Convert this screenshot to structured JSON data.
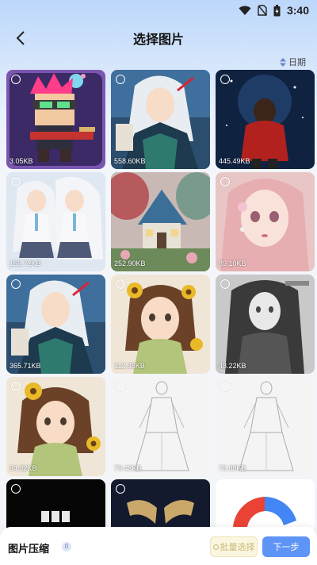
{
  "status": {
    "time": "3:40",
    "icons": [
      "wifi-icon",
      "no-sim-icon",
      "battery-icon"
    ]
  },
  "header": {
    "title": "选择图片",
    "back_icon": "back-arrow-icon"
  },
  "sort": {
    "label": "日期",
    "icon": "sort-arrows-icon"
  },
  "images": [
    {
      "size": "3.05KB",
      "subject": "pixel-art-guitarist"
    },
    {
      "size": "558.60KB",
      "subject": "anime-girl-white-hair-blue-jacket"
    },
    {
      "size": "445.49KB",
      "subject": "boy-red-shirt-night-sky"
    },
    {
      "size": "155.72KB",
      "subject": "anime-girls-school-uniform"
    },
    {
      "size": "252.90KB",
      "subject": "fantasy-house-landscape"
    },
    {
      "size": "89.10KB",
      "subject": "pink-haired-girl-portrait"
    },
    {
      "size": "365.71KB",
      "subject": "anime-girl-white-hair-blue-jacket"
    },
    {
      "size": "112.38KB",
      "subject": "girl-with-sunflowers"
    },
    {
      "size": "48.22KB",
      "subject": "grayscale-girl-sketch"
    },
    {
      "size": "94.82KB",
      "subject": "girl-with-sunflowers"
    },
    {
      "size": "79.43KB",
      "subject": "pencil-sketch-figure"
    },
    {
      "size": "75.88KB",
      "subject": "pencil-sketch-figure"
    },
    {
      "size": "",
      "subject": "black-tile"
    },
    {
      "size": "",
      "subject": "dark-ornament"
    },
    {
      "size": "",
      "subject": "google-logo"
    }
  ],
  "bottom": {
    "title": "图片压缩",
    "count": "0",
    "batch_label": "批量选择",
    "next_label": "下一步"
  },
  "colors": {
    "accent": "#5f94f7",
    "batch_bg": "#fbf6df"
  }
}
